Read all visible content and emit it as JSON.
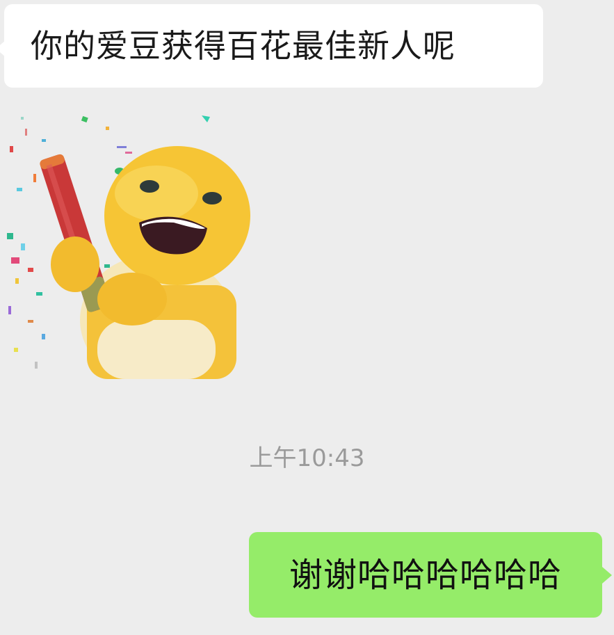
{
  "conversation": {
    "incoming_message": {
      "text": "你的爱豆获得百花最佳新人呢"
    },
    "sticker": {
      "description_icon": "celebration-sticker-icon"
    },
    "timestamp": "上午10:43",
    "outgoing_message": {
      "text": "谢谢哈哈哈哈哈哈"
    }
  },
  "colors": {
    "background": "#ededed",
    "incoming_bubble": "#ffffff",
    "outgoing_bubble": "#95ec69",
    "timestamp_text": "#9a9a9a"
  }
}
